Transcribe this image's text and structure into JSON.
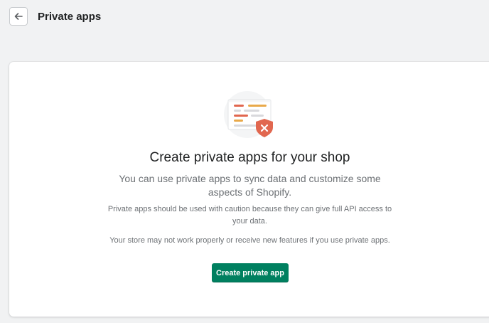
{
  "header": {
    "title": "Private apps",
    "back_icon": "arrow-left-icon"
  },
  "empty_state": {
    "illustration_icon": "document-blocked-shield-icon",
    "heading": "Create private apps for your shop",
    "lead": "You can use private apps to sync data and customize some aspects of Shopify.",
    "caution": "Private apps should be used with caution because they can give full API access to your data.",
    "warning": "Your store may not work properly or receive new features if you use private apps.",
    "button_label": "Create private app"
  },
  "colors": {
    "page_background": "#f1f2f3",
    "card_background": "#ffffff",
    "primary": "#008060",
    "subdued_text": "#6d7175",
    "shield": "#e1674f"
  }
}
